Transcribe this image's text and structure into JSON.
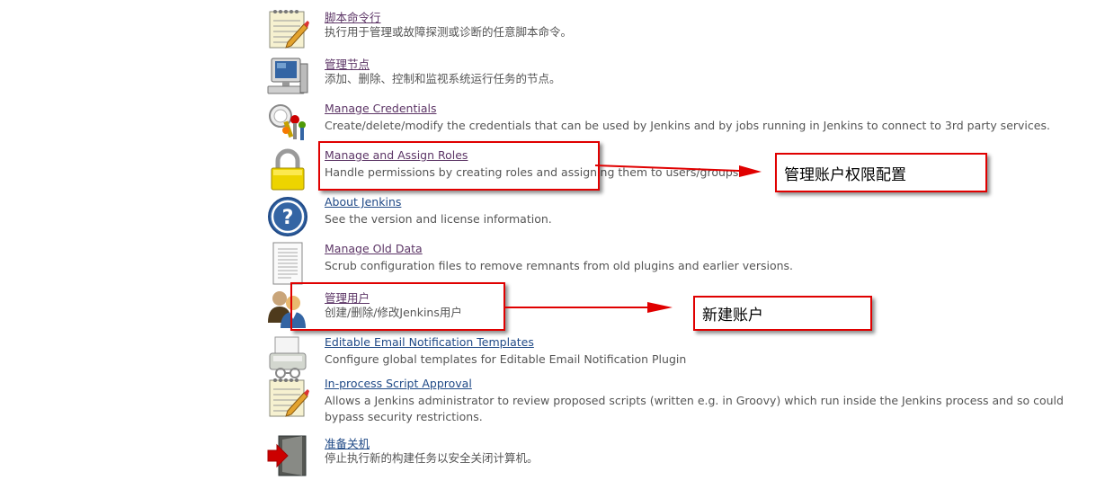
{
  "items": [
    {
      "title": "脚本命令行",
      "desc": "执行用于管理或故障探测或诊断的任意脚本命令。",
      "icon": "notepad-icon"
    },
    {
      "title": "管理节点",
      "desc": "添加、删除、控制和监视系统运行任务的节点。",
      "icon": "computer-icon"
    },
    {
      "title": "Manage Credentials",
      "desc": "Create/delete/modify the credentials that can be used by Jenkins and by jobs running in Jenkins to connect to 3rd party services.",
      "icon": "keys-icon"
    },
    {
      "title": "Manage and Assign Roles",
      "desc": "Handle permissions by creating roles and assigning them to users/groups",
      "icon": "padlock-icon"
    },
    {
      "title": "About Jenkins",
      "desc": "See the version and license information.",
      "icon": "help-icon"
    },
    {
      "title": "Manage Old Data",
      "desc": "Scrub configuration files to remove remnants from old plugins and earlier versions.",
      "icon": "document-icon"
    },
    {
      "title": "管理用户",
      "desc": "创建/删除/修改Jenkins用户",
      "icon": "users-icon"
    },
    {
      "title": "Editable Email Notification Templates",
      "desc": "Configure global templates for Editable Email Notification Plugin",
      "icon": "email-templates-icon"
    },
    {
      "title": "In-process Script Approval",
      "desc": "Allows a Jenkins administrator to review proposed scripts (written e.g. in Groovy) which run inside the Jenkins process and so could bypass security restrictions.",
      "icon": "notepad-icon"
    },
    {
      "title": "准备关机",
      "desc": "停止执行新的构建任务以安全关闭计算机。",
      "icon": "shutdown-icon"
    }
  ],
  "annotations": {
    "roles_note": "管理账户权限配置",
    "users_note": "新建账户",
    "color": "#e00000"
  }
}
